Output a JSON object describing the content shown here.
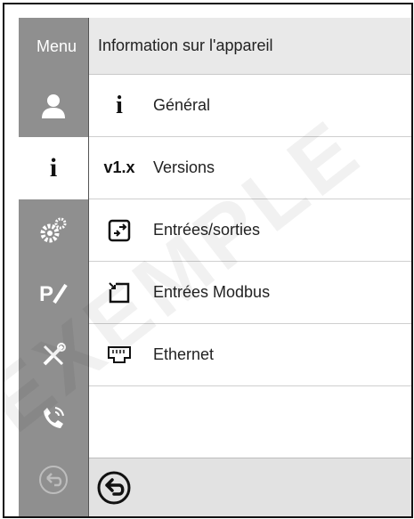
{
  "sidebar": {
    "menu_label": "Menu",
    "items": [
      {
        "icon": "user-icon",
        "active": false
      },
      {
        "icon": "info-icon",
        "active": true
      },
      {
        "icon": "gears-icon",
        "active": false
      },
      {
        "icon": "program-edit-icon",
        "active": false
      },
      {
        "icon": "tools-icon",
        "active": false
      },
      {
        "icon": "phone-service-icon",
        "active": false
      },
      {
        "icon": "back-disabled-icon",
        "active": false
      }
    ]
  },
  "main": {
    "title": "Information sur l'appareil",
    "items": [
      {
        "label": "Général",
        "icon": "info-icon"
      },
      {
        "label": "Versions",
        "icon": "version-icon",
        "icon_text": "v1.x"
      },
      {
        "label": "Entrées/sorties",
        "icon": "inputs-outputs-icon"
      },
      {
        "label": "Entrées Modbus",
        "icon": "modbus-input-icon"
      },
      {
        "label": "Ethernet",
        "icon": "ethernet-icon"
      }
    ]
  },
  "footer": {
    "back_icon": "back-arrow-icon"
  },
  "watermark": "EXEMPLE",
  "colors": {
    "sidebar": "#8f8f8f",
    "header": "#e9e9e9",
    "footer": "#e2e2e2",
    "text": "#222222"
  }
}
